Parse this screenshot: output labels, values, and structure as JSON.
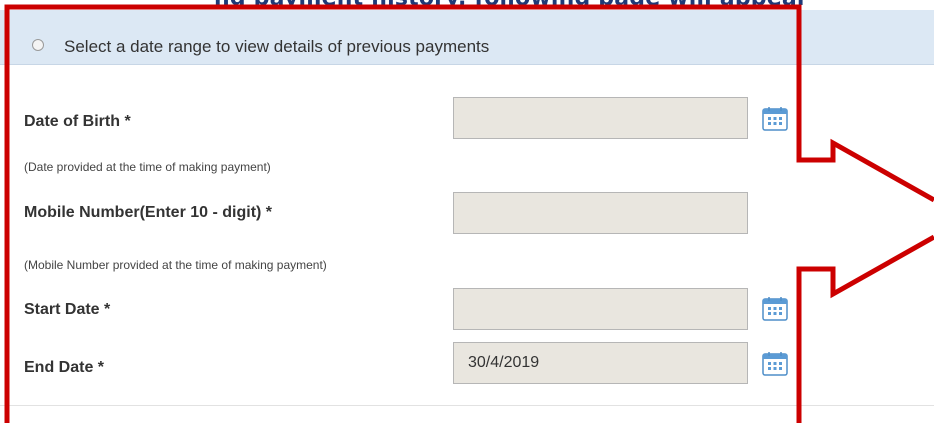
{
  "partial_heading": "ng payment history, following page will appear",
  "range_option": {
    "label": "Select a date range to view details of previous payments"
  },
  "form": {
    "dob": {
      "label": "Date of Birth *",
      "note": "(Date provided at the time of making payment)",
      "value": ""
    },
    "mobile": {
      "label": "Mobile Number(Enter 10 - digit) *",
      "note": "(Mobile Number provided at the time of making payment)",
      "value": ""
    },
    "start_date": {
      "label": "Start Date *",
      "value": ""
    },
    "end_date": {
      "label": "End Date *",
      "value": "30/4/2019"
    }
  },
  "colors": {
    "highlight": "#cc0000",
    "band": "#dce8f4",
    "field_bg": "#e9e6df",
    "heading": "#1f3a77"
  }
}
